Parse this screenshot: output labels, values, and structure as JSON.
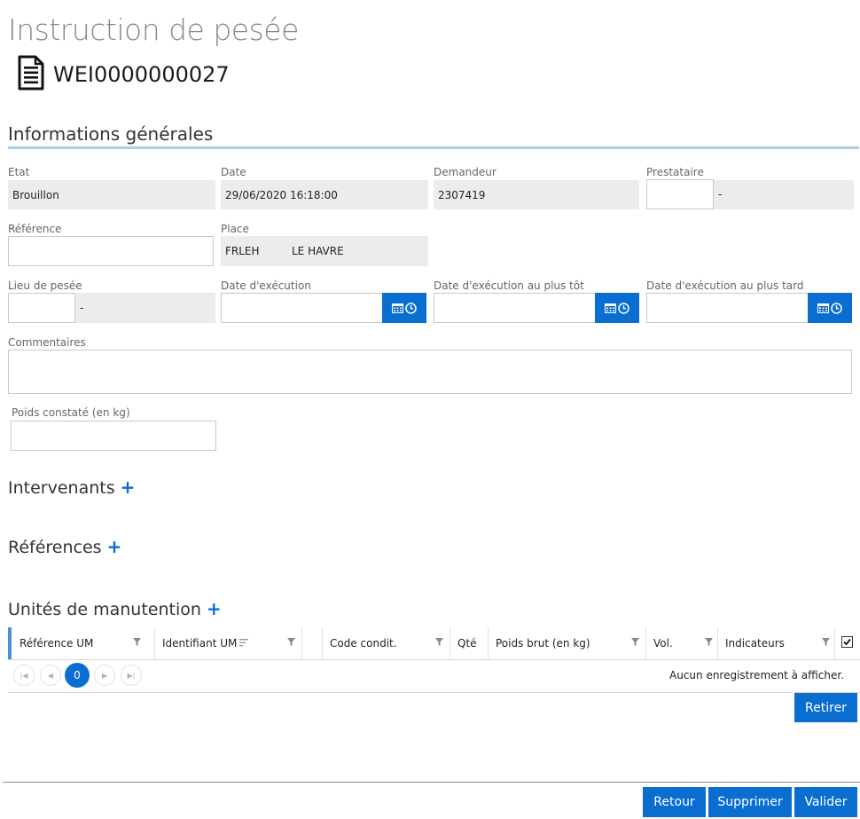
{
  "page": {
    "title": "Instruction de pesée",
    "doc_number": "WEI0000000027"
  },
  "general": {
    "section_title": "Informations générales",
    "etat": {
      "label": "Etat",
      "value": "Brouillon"
    },
    "date": {
      "label": "Date",
      "value": "29/06/2020 16:18:00"
    },
    "demandeur": {
      "label": "Demandeur",
      "value": "2307419"
    },
    "prestataire": {
      "label": "Prestataire",
      "value": "",
      "desc": "-"
    },
    "reference": {
      "label": "Référence",
      "value": ""
    },
    "place": {
      "label": "Place",
      "code": "FRLEH",
      "name": "LE HAVRE"
    },
    "lieu": {
      "label": "Lieu de pesée",
      "value": "",
      "desc": "-"
    },
    "date_exec": {
      "label": "Date d'exécution",
      "value": ""
    },
    "date_exec_tot": {
      "label": "Date d'exécution au plus tôt",
      "value": ""
    },
    "date_exec_tard": {
      "label": "Date d'exécution au plus tard",
      "value": ""
    },
    "commentaires": {
      "label": "Commentaires",
      "value": ""
    },
    "poids": {
      "label": "Poids constaté (en kg)",
      "value": ""
    }
  },
  "intervenants": {
    "title": "Intervenants",
    "add": "+"
  },
  "references": {
    "title": "Références",
    "add": "+"
  },
  "unites": {
    "title": "Unités de manutention",
    "add": "+",
    "columns": [
      "Référence UM",
      "Identifiant UM",
      "",
      "Code condit.",
      "Qté",
      "Poids brut (en kg)",
      "Vol.",
      "Indicateurs"
    ],
    "pager": {
      "current_page": "0"
    },
    "empty_message": "Aucun enregistrement à afficher.",
    "retirer_label": "Retirer"
  },
  "footer": {
    "retour": "Retour",
    "supprimer": "Supprimer",
    "valider": "Valider"
  },
  "colors": {
    "accent": "#0a6ed1",
    "readonly_bg": "#ececec",
    "section_rule": "#a8d0e6"
  },
  "icons": {
    "calendar": "calendar-icon",
    "clock": "clock-icon",
    "document": "document-icon",
    "filter": "filter-icon"
  }
}
